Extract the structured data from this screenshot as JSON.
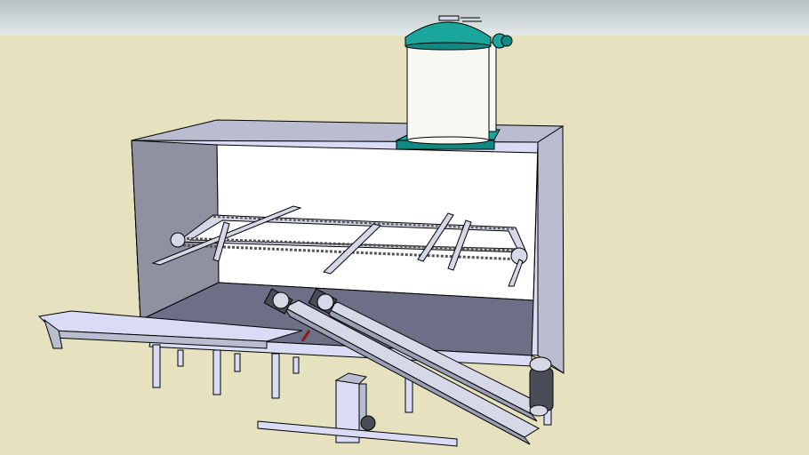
{
  "colors": {
    "sky_top": "#b5c1c3",
    "sky_bottom": "#e3e9ea",
    "ground": "#e6e2bf",
    "box_face": "#d9dcf4",
    "box_side": "#babdcf",
    "box_inner_left": "#8f91a0",
    "box_floor": "#6c6f86",
    "window": "#ffffff",
    "tank_body": "#f7f8f3",
    "tank_lid": "#1aa59d",
    "tank_lid_dark": "#0f8a83",
    "steel": "#d6d8e8",
    "steel_dark": "#9aa0b4",
    "motor": "#4a4d57",
    "outline": "#000000"
  },
  "scene": {
    "objects": [
      "storage-tank",
      "enclosure-box",
      "chain-conveyor",
      "inclined-screw-conveyor-left",
      "inclined-screw-conveyor-right",
      "feed-chute",
      "support-legs",
      "vertical-hopper",
      "drive-motor"
    ]
  }
}
